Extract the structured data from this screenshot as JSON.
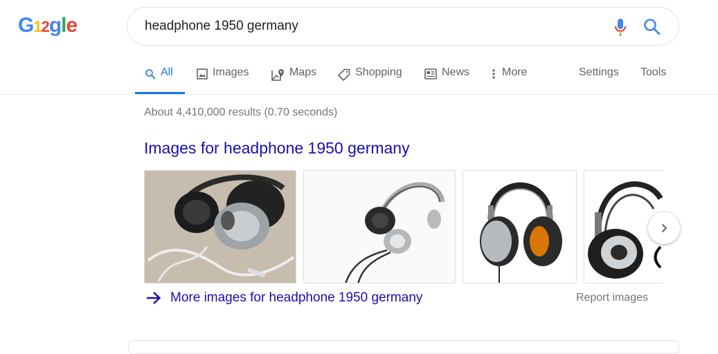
{
  "logo": {
    "letters": [
      "G",
      "1",
      "2",
      "g",
      "l",
      "e"
    ]
  },
  "search": {
    "query": "headphone 1950 germany"
  },
  "tabs": [
    {
      "label": "All",
      "icon": "search-icon"
    },
    {
      "label": "Images",
      "icon": "image-icon"
    },
    {
      "label": "Maps",
      "icon": "map-icon"
    },
    {
      "label": "Shopping",
      "icon": "tag-icon"
    },
    {
      "label": "News",
      "icon": "news-icon"
    },
    {
      "label": "More",
      "icon": "more-vertical-icon"
    },
    {
      "label": "Settings"
    },
    {
      "label": "Tools"
    }
  ],
  "stats": "About 4,410,000 results (0.70 seconds)",
  "images_section": {
    "title": "Images for headphone 1950 germany",
    "more_link": "More images for headphone 1950 germany",
    "report": "Report images",
    "thumbnails": [
      "headphones-photo-1",
      "headphones-photo-2",
      "headphones-photo-3",
      "headphones-photo-4"
    ]
  },
  "colors": {
    "link": "#1a0dab",
    "accent": "#1a73e8",
    "muted": "#70757a"
  }
}
